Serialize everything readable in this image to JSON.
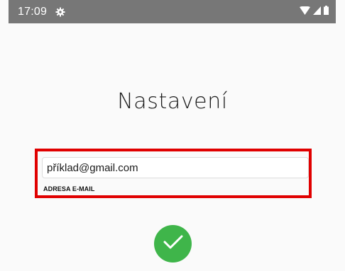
{
  "status_bar": {
    "time": "17:09",
    "icons": [
      "settings-gear-icon",
      "wifi-icon",
      "cellular-signal-icon",
      "battery-icon"
    ]
  },
  "screen": {
    "title": "Nastavení"
  },
  "email": {
    "value": "příklad@gmail.com",
    "label": "ADRESA E-MAIL"
  },
  "confirm": {
    "icon": "checkmark-icon",
    "color": "#3fb54a"
  },
  "highlight_color": "#e00000"
}
